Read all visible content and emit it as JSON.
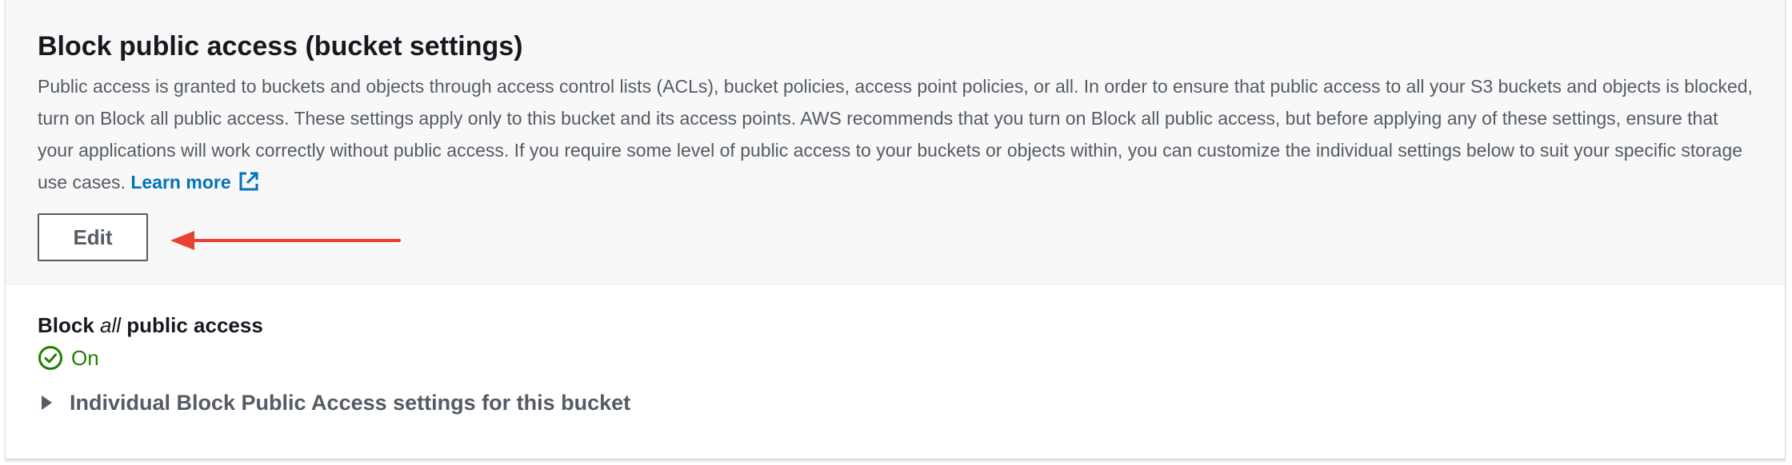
{
  "section": {
    "title": "Block public access (bucket settings)",
    "description": "Public access is granted to buckets and objects through access control lists (ACLs), bucket policies, access point policies, or all. In order to ensure that public access to all your S3 buckets and objects is blocked, turn on Block all public access. These settings apply only to this bucket and its access points. AWS recommends that you turn on Block all public access, but before applying any of these settings, ensure that your applications will work correctly without public access. If you require some level of public access to your buckets or objects within, you can customize the individual settings below to suit your specific storage use cases.",
    "learn_more_label": "Learn more",
    "learn_more_icon": "external-link-icon",
    "edit_label": "Edit"
  },
  "annotation": {
    "arrow_color": "#e8412e",
    "arrow_icon": "red-arrow-pointing-left"
  },
  "block_all": {
    "label_prefix": "Block ",
    "label_emphasis": "all",
    "label_suffix": " public access",
    "status_text": "On",
    "status_icon": "check-circle-icon",
    "status_color": "#1d8102"
  },
  "individual": {
    "label": "Individual Block Public Access settings for this bucket",
    "icon": "caret-right-icon"
  },
  "colors": {
    "link": "#0073bb",
    "header_bg": "#f8f8f8",
    "text_primary": "#16191f",
    "text_secondary": "#545b64"
  }
}
